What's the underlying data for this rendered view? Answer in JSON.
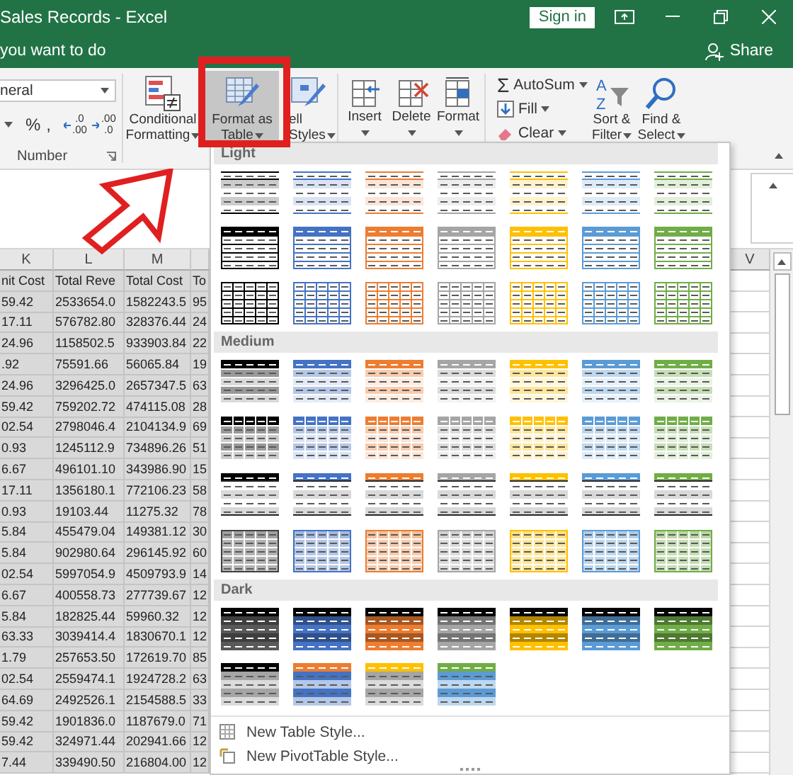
{
  "window": {
    "title": "Sales Records - Excel",
    "sign_in": "Sign in"
  },
  "tell_me": "you want to do",
  "share": "Share",
  "ribbon": {
    "number_group": {
      "format": "neral",
      "symbols": [
        "%",
        ","
      ],
      "decimal_buttons": [
        {
          "top": ".0",
          "bottom": ".00"
        },
        {
          "top": ".00",
          "bottom": ".0"
        }
      ],
      "label": "Number"
    },
    "styles_group": [
      {
        "kind": "conditional",
        "lines": [
          "Conditional",
          "Formatting"
        ],
        "expanded": false
      },
      {
        "kind": "table",
        "lines": [
          "Format as",
          "Table"
        ],
        "expanded": true
      },
      {
        "kind": "cell",
        "lines": [
          "ell",
          "Styles"
        ],
        "expanded": false
      }
    ],
    "cells_group": [
      {
        "kind": "insert",
        "label": "Insert"
      },
      {
        "kind": "delete",
        "label": "Delete"
      },
      {
        "kind": "format",
        "label": "Format"
      }
    ],
    "editing_group": {
      "autosum": {
        "icon": "Σ",
        "label": "AutoSum"
      },
      "fill": "Fill",
      "clear": "Clear",
      "sort": {
        "letters": [
          "A",
          "Z"
        ],
        "lines": [
          "Sort &",
          "Filter"
        ]
      },
      "find": {
        "lines": [
          "Find &",
          "Select"
        ]
      }
    }
  },
  "sheet": {
    "columns": [
      "K",
      "L",
      "M",
      ""
    ],
    "right_column": "V",
    "header": [
      "nit Cost",
      "Total Reve",
      "Total Cost",
      "To"
    ],
    "rows": [
      [
        "59.42",
        "2533654.0",
        "1582243.5",
        "95"
      ],
      [
        "17.11",
        "576782.80",
        "328376.44",
        "24"
      ],
      [
        "24.96",
        "1158502.5",
        "933903.84",
        "22"
      ],
      [
        ".92",
        "75591.66",
        "56065.84",
        "19"
      ],
      [
        "24.96",
        "3296425.0",
        "2657347.5",
        "63"
      ],
      [
        "59.42",
        "759202.72",
        "474115.08",
        "28"
      ],
      [
        "02.54",
        "2798046.4",
        "2104134.9",
        "69"
      ],
      [
        "0.93",
        "1245112.9",
        "734896.26",
        "51"
      ],
      [
        "6.67",
        "496101.10",
        "343986.90",
        "15"
      ],
      [
        "17.11",
        "1356180.1",
        "772106.23",
        "58"
      ],
      [
        "0.93",
        "19103.44",
        "11275.32",
        "78"
      ],
      [
        "5.84",
        "455479.04",
        "149381.12",
        "30"
      ],
      [
        "5.84",
        "902980.64",
        "296145.92",
        "60"
      ],
      [
        "02.54",
        "5997054.9",
        "4509793.9",
        "14"
      ],
      [
        "6.67",
        "400558.73",
        "277739.67",
        "12"
      ],
      [
        "5.84",
        "182825.44",
        "59960.32",
        "12"
      ],
      [
        "63.33",
        "3039414.4",
        "1830670.1",
        "12"
      ],
      [
        "1.79",
        "257653.50",
        "172619.70",
        "85"
      ],
      [
        "02.54",
        "2559474.1",
        "1924728.2",
        "63"
      ],
      [
        "64.69",
        "2492526.1",
        "2154588.5",
        "33"
      ],
      [
        "59.42",
        "1901836.0",
        "1187679.0",
        "71"
      ],
      [
        "59.42",
        "324971.44",
        "202941.66",
        "12"
      ],
      [
        "7.44",
        "339490.50",
        "216804.00",
        "12"
      ]
    ]
  },
  "gallery": {
    "sections": [
      {
        "title": "Light",
        "rows": [
          {
            "kind": "light-banded",
            "swatches": [
              {
                "color": "#000000"
              },
              {
                "color": "#4472c4"
              },
              {
                "color": "#ed7d31"
              },
              {
                "color": "#a5a5a5"
              },
              {
                "color": "#ffc000"
              },
              {
                "color": "#5b9bd5"
              },
              {
                "color": "#70ad47"
              }
            ]
          },
          {
            "kind": "light-bordered",
            "swatches": [
              {
                "color": "#000000"
              },
              {
                "color": "#4472c4"
              },
              {
                "color": "#ed7d31"
              },
              {
                "color": "#a5a5a5"
              },
              {
                "color": "#ffc000"
              },
              {
                "color": "#5b9bd5"
              },
              {
                "color": "#70ad47"
              }
            ]
          },
          {
            "kind": "light-grid",
            "swatches": [
              {
                "color": "#000000"
              },
              {
                "color": "#4472c4"
              },
              {
                "color": "#ed7d31"
              },
              {
                "color": "#a5a5a5"
              },
              {
                "color": "#ffc000"
              },
              {
                "color": "#5b9bd5"
              },
              {
                "color": "#70ad47"
              }
            ]
          }
        ]
      },
      {
        "title": "Medium",
        "rows": [
          {
            "kind": "medium-banded",
            "swatches": [
              {
                "color": "#000000"
              },
              {
                "color": "#4472c4"
              },
              {
                "color": "#ed7d31"
              },
              {
                "color": "#a5a5a5"
              },
              {
                "color": "#ffc000"
              },
              {
                "color": "#5b9bd5"
              },
              {
                "color": "#70ad47"
              }
            ]
          },
          {
            "kind": "medium-grid",
            "swatches": [
              {
                "color": "#000000"
              },
              {
                "color": "#4472c4"
              },
              {
                "color": "#ed7d31"
              },
              {
                "color": "#a5a5a5"
              },
              {
                "color": "#ffc000"
              },
              {
                "color": "#5b9bd5"
              },
              {
                "color": "#70ad47"
              }
            ]
          },
          {
            "kind": "medium-lined",
            "swatches": [
              {
                "color": "#000000"
              },
              {
                "color": "#4472c4"
              },
              {
                "color": "#ed7d31"
              },
              {
                "color": "#a5a5a5"
              },
              {
                "color": "#ffc000"
              },
              {
                "color": "#5b9bd5"
              },
              {
                "color": "#70ad47"
              }
            ]
          },
          {
            "kind": "medium-filled",
            "swatches": [
              {
                "color": "#404040"
              },
              {
                "color": "#4472c4"
              },
              {
                "color": "#ed7d31"
              },
              {
                "color": "#a5a5a5"
              },
              {
                "color": "#ffc000"
              },
              {
                "color": "#5b9bd5"
              },
              {
                "color": "#70ad47"
              }
            ]
          }
        ]
      },
      {
        "title": "Dark",
        "rows": [
          {
            "kind": "dark-banded",
            "swatches": [
              {
                "color": "#595959"
              },
              {
                "color": "#4472c4"
              },
              {
                "color": "#ed7d31"
              },
              {
                "color": "#a5a5a5"
              },
              {
                "color": "#ffc000"
              },
              {
                "color": "#5b9bd5"
              },
              {
                "color": "#70ad47"
              }
            ]
          },
          {
            "kind": "dark-paired",
            "swatches": [
              {
                "color": "#000000",
                "band": {
                  "color": "#a5a5a5"
                }
              },
              {
                "color": "#ed7d31",
                "band": {
                  "color": "#4472c4"
                }
              },
              {
                "color": "#ffc000",
                "band": {
                  "color": "#a5a5a5"
                }
              },
              {
                "color": "#70ad47",
                "band": {
                  "color": "#5b9bd5"
                }
              }
            ]
          }
        ]
      }
    ],
    "menu": [
      {
        "kind": "table",
        "label": "New Table Style..."
      },
      {
        "kind": "pivot",
        "label": "New PivotTable Style..."
      }
    ]
  }
}
